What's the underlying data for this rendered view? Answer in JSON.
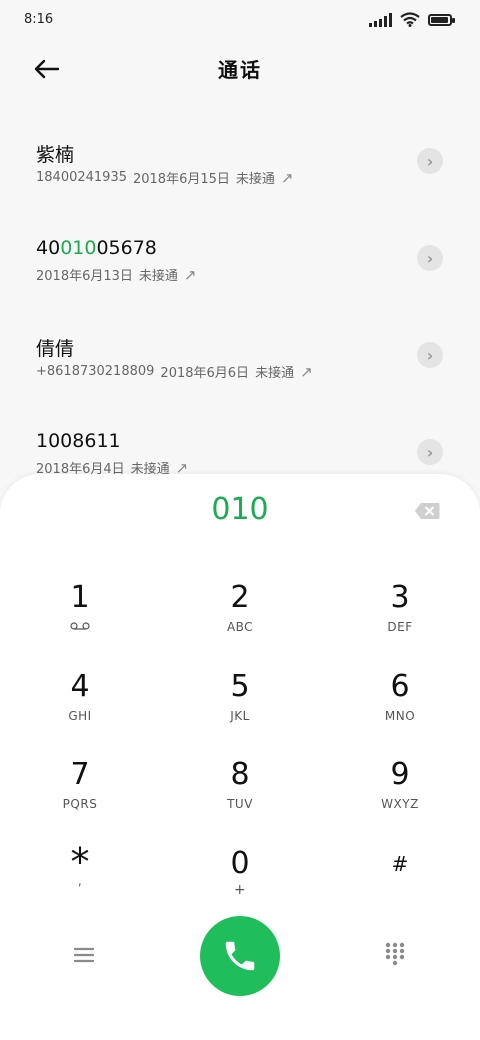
{
  "status_bar": {
    "time": "8:16"
  },
  "header": {
    "title": "通话"
  },
  "call_log": [
    {
      "name": "紫楠",
      "number": "18400241935",
      "date": "2018年6月15日",
      "status": "未接通"
    },
    {
      "name_pre": "40",
      "name_hl": "010",
      "name_post": "05678",
      "number": "",
      "date": "2018年6月13日",
      "status": "未接通"
    },
    {
      "name": "倩倩",
      "number": "+8618730218809",
      "date": "2018年6月6日",
      "status": "未接通"
    },
    {
      "name": "1008611",
      "number": "",
      "date": "2018年6月4日",
      "status": "未接通"
    }
  ],
  "dialpad": {
    "input": "010",
    "keys": [
      {
        "digit": "1",
        "letters": ""
      },
      {
        "digit": "2",
        "letters": "ABC"
      },
      {
        "digit": "3",
        "letters": "DEF"
      },
      {
        "digit": "4",
        "letters": "GHI"
      },
      {
        "digit": "5",
        "letters": "JKL"
      },
      {
        "digit": "6",
        "letters": "MNO"
      },
      {
        "digit": "7",
        "letters": "PQRS"
      },
      {
        "digit": "8",
        "letters": "TUV"
      },
      {
        "digit": "9",
        "letters": "WXYZ"
      },
      {
        "digit": "*",
        "letters": ","
      },
      {
        "digit": "0",
        "letters": "+"
      },
      {
        "digit": "#",
        "letters": ""
      }
    ]
  },
  "colors": {
    "accent": "#1cab52",
    "call_button": "#1fbe5a"
  },
  "icons": [
    "back-arrow-icon",
    "backspace-icon",
    "voicemail-icon",
    "menu-icon",
    "phone-icon",
    "dialpad-icon",
    "outgoing-call-icon",
    "chevron-right-icon"
  ]
}
